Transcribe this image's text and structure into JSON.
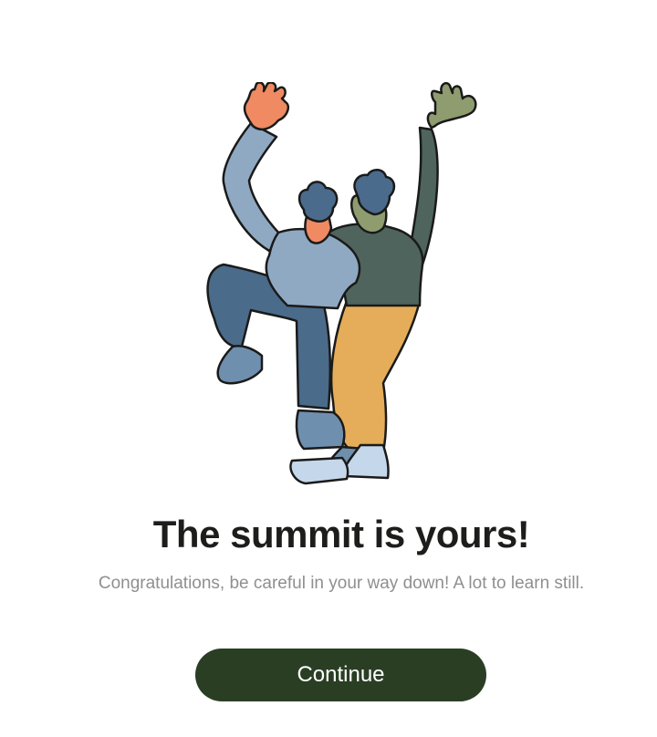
{
  "illustration": {
    "icon": "celebrating-hikers-illustration",
    "colors": {
      "outline": "#1a1a1a",
      "light_blue_shirt": "#8fa9c3",
      "dark_green_shirt": "#4f645c",
      "navy_pants": "#4a6b8a",
      "mustard_pants": "#e5ad59",
      "hair": "#4b6b8c",
      "skin_left": "#ef8a63",
      "skin_right": "#8f9c6f",
      "shoe_light": "#c5d7ea",
      "shoe_dark": "#6f8fae"
    }
  },
  "content": {
    "title": "The summit is yours!",
    "subtitle": "Congratulations, be careful in your way down! A lot to learn still."
  },
  "actions": {
    "continue_label": "Continue",
    "continue_color": "#2a3e24"
  }
}
